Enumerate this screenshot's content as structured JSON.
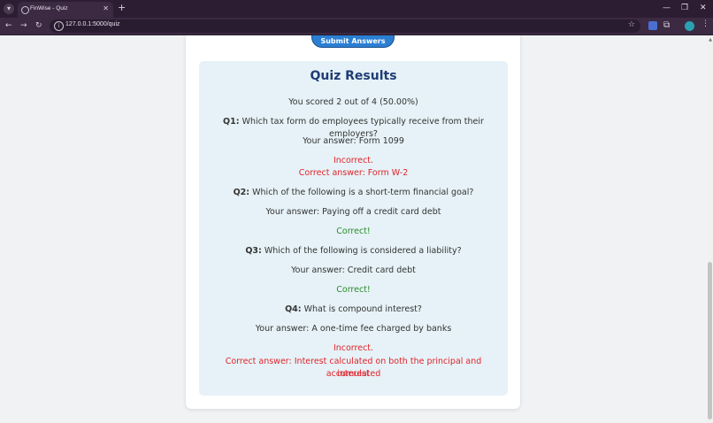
{
  "browser": {
    "tab_title": "FinWise - Quiz",
    "url": "127.0.0.1:5000/quiz"
  },
  "page": {
    "submit_label": "Submit Answers",
    "results_title": "Quiz Results",
    "score_text": "You scored 2 out of 4 (50.00%)",
    "questions": [
      {
        "num": "Q1:",
        "text": "Which tax form do employees typically receive from their employers?",
        "answer": "Your answer: Form 1099",
        "verdict": "Incorrect.",
        "correct": "Correct answer: Form W-2"
      },
      {
        "num": "Q2:",
        "text": "Which of the following is a short-term financial goal?",
        "answer": "Your answer: Paying off a credit card debt",
        "verdict": "Correct!"
      },
      {
        "num": "Q3:",
        "text": "Which of the following is considered a liability?",
        "answer": "Your answer: Credit card debt",
        "verdict": "Correct!"
      },
      {
        "num": "Q4:",
        "text": "What is compound interest?",
        "answer": "Your answer: A one-time fee charged by banks",
        "verdict": "Incorrect.",
        "correct_line1": "Correct answer: Interest calculated on both the principal and accumulated",
        "correct_line2": "interest"
      }
    ]
  },
  "colors": {
    "incorrect": "#e0242a",
    "correct": "#2a8b2a",
    "title": "#1f3d73",
    "results_bg": "#e6f2f7"
  }
}
